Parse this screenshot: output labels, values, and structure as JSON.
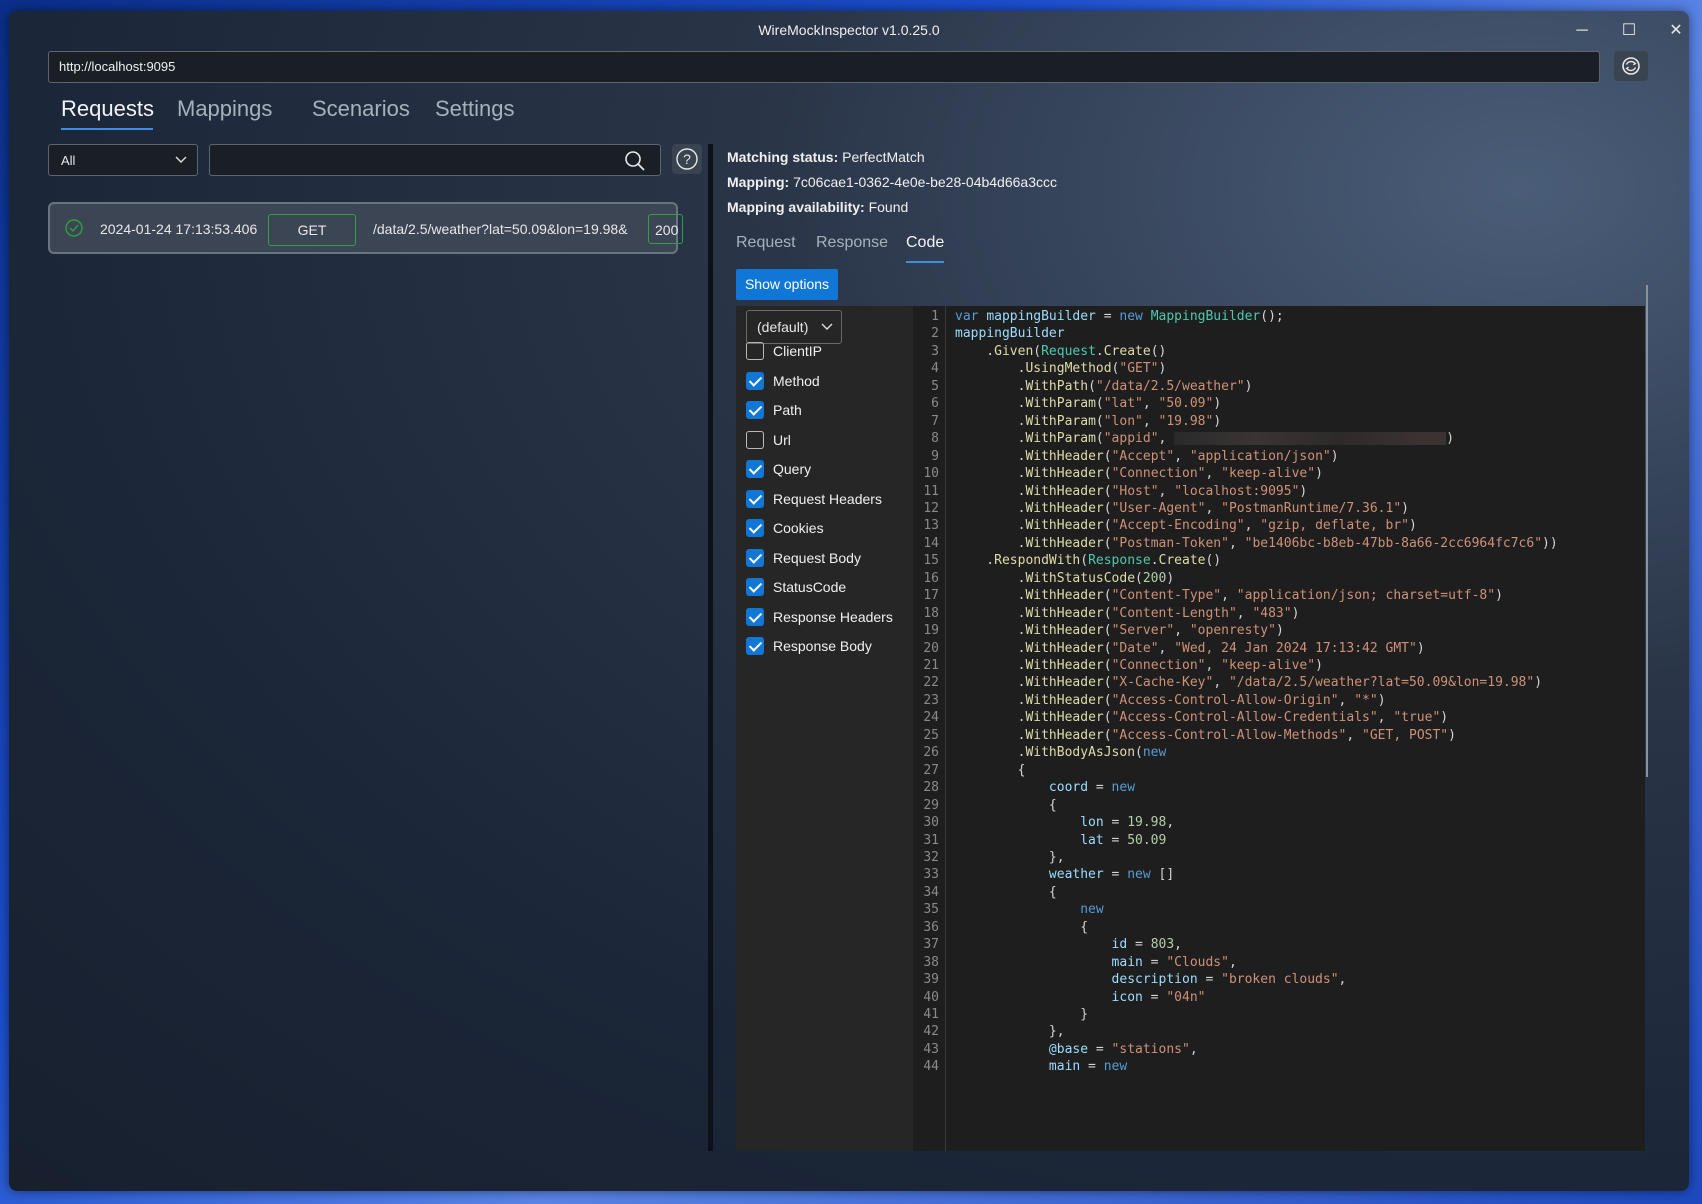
{
  "window": {
    "title": "WireMockInspector v1.0.25.0",
    "minimize_glyph": "─",
    "maximize_glyph": "☐",
    "close_glyph": "✕"
  },
  "url_bar": {
    "value": "http://localhost:9095"
  },
  "main_tabs": [
    {
      "label": "Requests",
      "active": true
    },
    {
      "label": "Mappings",
      "active": false
    },
    {
      "label": "Scenarios",
      "active": false
    },
    {
      "label": "Settings",
      "active": false
    }
  ],
  "filter": {
    "selected": "All",
    "search_value": ""
  },
  "requests": [
    {
      "timestamp": "2024-01-24 17:13:53.406",
      "method": "GET",
      "path": "/data/2.5/weather?lat=50.09&lon=19.98&",
      "status": "200"
    }
  ],
  "details": {
    "matching_status_label": "Matching status:",
    "matching_status_value": "PerfectMatch",
    "mapping_label": "Mapping:",
    "mapping_value": "7c06cae1-0362-4e0e-be28-04b4d66a3ccc",
    "availability_label": "Mapping availability:",
    "availability_value": "Found"
  },
  "detail_tabs": [
    {
      "label": "Request",
      "active": false
    },
    {
      "label": "Response",
      "active": false
    },
    {
      "label": "Code",
      "active": true
    }
  ],
  "show_options_label": "Show options",
  "code_options": {
    "preset": "(default)",
    "items": [
      {
        "label": "ClientIP",
        "checked": false
      },
      {
        "label": "Method",
        "checked": true
      },
      {
        "label": "Path",
        "checked": true
      },
      {
        "label": "Url",
        "checked": false
      },
      {
        "label": "Query",
        "checked": true
      },
      {
        "label": "Request Headers",
        "checked": true
      },
      {
        "label": "Cookies",
        "checked": true
      },
      {
        "label": "Request Body",
        "checked": true
      },
      {
        "label": "StatusCode",
        "checked": true
      },
      {
        "label": "Response Headers",
        "checked": true
      },
      {
        "label": "Response Body",
        "checked": true
      }
    ]
  },
  "code": {
    "lines": [
      "var mappingBuilder = new MappingBuilder();",
      "mappingBuilder",
      "    .Given(Request.Create()",
      "        .UsingMethod(\"GET\")",
      "        .WithPath(\"/data/2.5/weather\")",
      "        .WithParam(\"lat\", \"50.09\")",
      "        .WithParam(\"lon\", \"19.98\")",
      "        .WithParam(\"appid\", [REDACTED])",
      "        .WithHeader(\"Accept\", \"application/json\")",
      "        .WithHeader(\"Connection\", \"keep-alive\")",
      "        .WithHeader(\"Host\", \"localhost:9095\")",
      "        .WithHeader(\"User-Agent\", \"PostmanRuntime/7.36.1\")",
      "        .WithHeader(\"Accept-Encoding\", \"gzip, deflate, br\")",
      "        .WithHeader(\"Postman-Token\", \"be1406bc-b8eb-47bb-8a66-2cc6964fc7c6\"))",
      "    .RespondWith(Response.Create()",
      "        .WithStatusCode(200)",
      "        .WithHeader(\"Content-Type\", \"application/json; charset=utf-8\")",
      "        .WithHeader(\"Content-Length\", \"483\")",
      "        .WithHeader(\"Server\", \"openresty\")",
      "        .WithHeader(\"Date\", \"Wed, 24 Jan 2024 17:13:42 GMT\")",
      "        .WithHeader(\"Connection\", \"keep-alive\")",
      "        .WithHeader(\"X-Cache-Key\", \"/data/2.5/weather?lat=50.09&lon=19.98\")",
      "        .WithHeader(\"Access-Control-Allow-Origin\", \"*\")",
      "        .WithHeader(\"Access-Control-Allow-Credentials\", \"true\")",
      "        .WithHeader(\"Access-Control-Allow-Methods\", \"GET, POST\")",
      "        .WithBodyAsJson(new",
      "        {",
      "            coord = new",
      "            {",
      "                lon = 19.98,",
      "                lat = 50.09",
      "            },",
      "            weather = new []",
      "            {",
      "                new",
      "                {",
      "                    id = 803,",
      "                    main = \"Clouds\",",
      "                    description = \"broken clouds\",",
      "                    icon = \"04n\"",
      "                }",
      "            },",
      "            @base = \"stations\",",
      "            main = new"
    ]
  },
  "colors": {
    "accent": "#1177d6",
    "success": "#2ea043",
    "code_bg": "#1e1e1e"
  },
  "icons": {
    "refresh": "refresh-icon",
    "search": "search-icon",
    "help": "question-icon",
    "status_ok": "check-circle-icon",
    "dropdown": "chevron-down-icon"
  }
}
